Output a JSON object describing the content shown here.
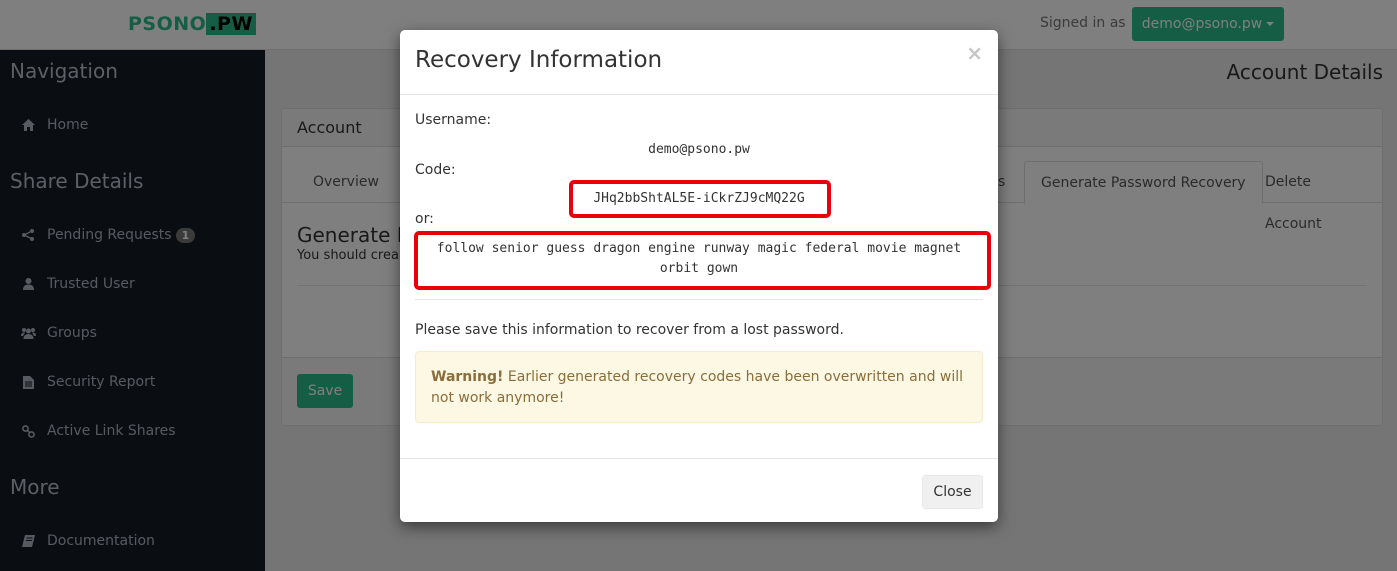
{
  "topbar": {
    "logo_main": "PSONO",
    "logo_dot": ".",
    "logo_suffix": "PW",
    "signed_in_label": "Signed in as",
    "user_button": "demo@psono.pw"
  },
  "sidebar": {
    "sections": [
      {
        "heading": "Navigation",
        "items": [
          {
            "label": "Home",
            "icon": "home-icon"
          }
        ]
      },
      {
        "heading": "Share Details",
        "items": [
          {
            "label": "Pending Requests",
            "icon": "share-icon",
            "badge": "1"
          },
          {
            "label": "Trusted User",
            "icon": "user-icon"
          },
          {
            "label": "Groups",
            "icon": "users-icon"
          },
          {
            "label": "Security Report",
            "icon": "file-icon"
          },
          {
            "label": "Active Link Shares",
            "icon": "link-icon"
          }
        ]
      },
      {
        "heading": "More",
        "items": [
          {
            "label": "Documentation",
            "icon": "book-icon"
          }
        ]
      }
    ]
  },
  "main": {
    "page_title": "Account Details",
    "panel_title": "Account",
    "tabs": [
      {
        "label": "Overview",
        "active": false
      },
      {
        "label": "s",
        "active": false
      },
      {
        "label": "Generate Password Recovery",
        "active": true
      },
      {
        "label": "Delete Account",
        "active": false
      }
    ],
    "section_title": "Generate P",
    "section_subtitle": "You should crea",
    "save_button": "Save"
  },
  "modal": {
    "title": "Recovery Information",
    "close_symbol": "×",
    "username_label": "Username:",
    "username_value": "demo@psono.pw",
    "code_label": "Code:",
    "code_value": "JHq2bbShtAL5E-iCkrZJ9cMQ22G",
    "or_label": "or:",
    "words_line1": "follow senior guess dragon engine runway magic federal movie magnet",
    "words_line2": "orbit gown",
    "info_text": "Please save this information to recover from a lost password.",
    "warning_strong": "Warning!",
    "warning_text": " Earlier generated recovery codes have been overwritten and will not work anymore!",
    "close_button": "Close"
  },
  "colors": {
    "accent": "#2dbb8a",
    "sidebar_bg": "#151c27",
    "highlight": "#e8000b",
    "warning_bg": "#fcf8e3",
    "warning_text": "#8a6d3b"
  }
}
